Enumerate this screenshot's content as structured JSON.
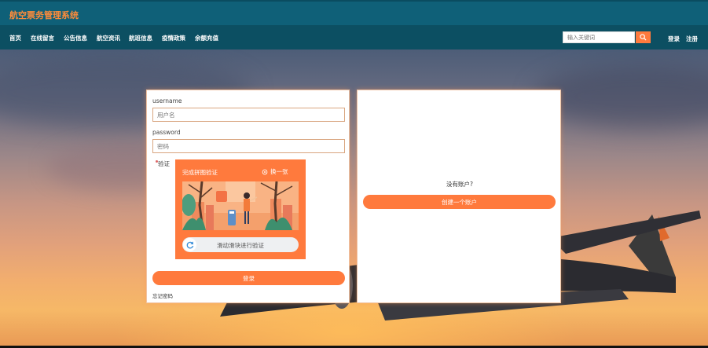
{
  "header": {
    "title": "航空票务管理系统"
  },
  "nav": {
    "items": [
      "首页",
      "在线留言",
      "公告信息",
      "航空资讯",
      "航班信息",
      "疫情政策",
      "余额充值"
    ]
  },
  "search": {
    "placeholder": "输入关键词",
    "icon": "search-icon"
  },
  "auth": {
    "login": "登录",
    "register": "注册"
  },
  "login_form": {
    "username_label": "username",
    "username_placeholder": "用户名",
    "password_label": "password",
    "password_placeholder": "密码",
    "verify_label": "验证",
    "captcha": {
      "title": "完成拼图验证",
      "refresh_label": "换一张",
      "slider_text": "滑动滑块进行验证"
    },
    "submit": "登录",
    "forgot": "忘记密码"
  },
  "register_panel": {
    "prompt": "没有账户?",
    "button": "创建一个账户"
  },
  "colors": {
    "accent": "#ff7a3d",
    "header_bg": "#0f6078",
    "nav_bg": "#0c4f62",
    "title": "#ff8c3a"
  }
}
